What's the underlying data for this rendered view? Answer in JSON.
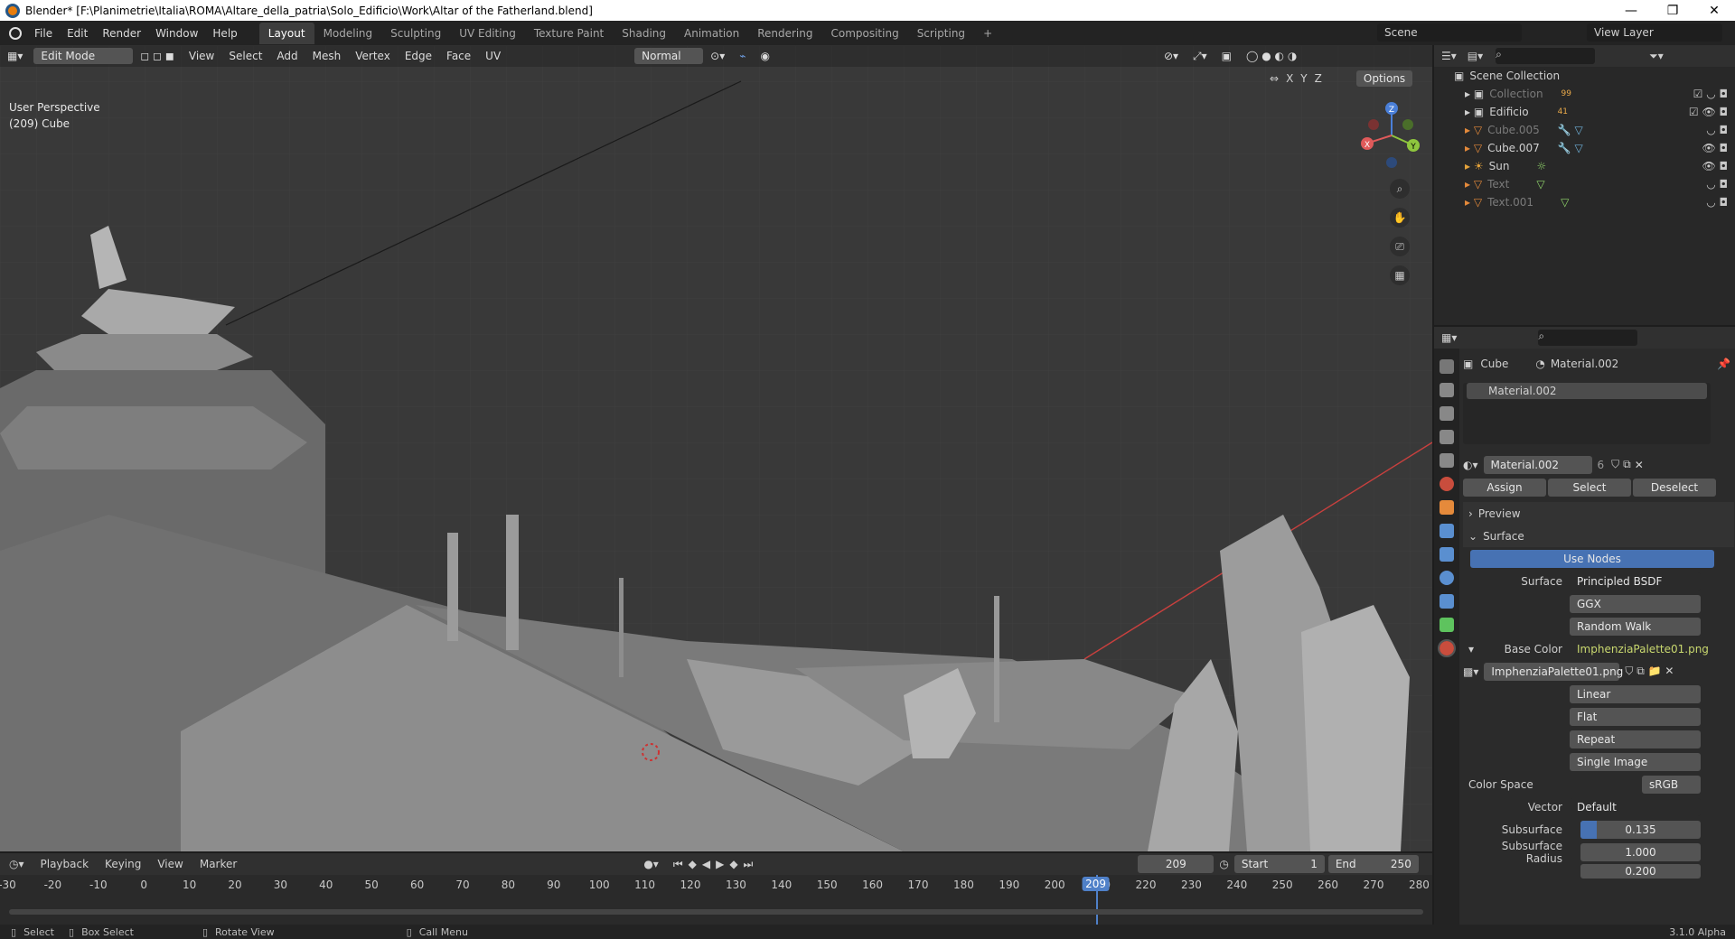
{
  "window": {
    "title": "Blender* [F:\\Planimetrie\\Italia\\ROMA\\Altare_della_patria\\Solo_Edificio\\Work\\Altar of the Fatherland.blend]"
  },
  "menu": [
    "File",
    "Edit",
    "Render",
    "Window",
    "Help"
  ],
  "workspaces": [
    "Layout",
    "Modeling",
    "Sculpting",
    "UV Editing",
    "Texture Paint",
    "Shading",
    "Animation",
    "Rendering",
    "Compositing",
    "Scripting"
  ],
  "active_workspace": "Layout",
  "scene": {
    "name": "Scene",
    "view_layer": "View Layer"
  },
  "viewport": {
    "mode": "Edit Mode",
    "menus": [
      "View",
      "Select",
      "Add",
      "Mesh",
      "Vertex",
      "Edge",
      "Face",
      "UV"
    ],
    "orientation": "Normal",
    "options_label": "Options",
    "axes": [
      "X",
      "Y",
      "Z"
    ],
    "info_line1": "User Perspective",
    "info_line2": "(209) Cube",
    "gizmo": {
      "x": "X",
      "y": "Y",
      "z": "Z"
    }
  },
  "outliner": {
    "root": "Scene Collection",
    "items": [
      {
        "name": "Collection",
        "badge": "99",
        "dim": true
      },
      {
        "name": "Edificio",
        "badge": "41",
        "dim": false
      },
      {
        "name": "Cube.005",
        "dim": true
      },
      {
        "name": "Cube.007",
        "dim": false
      },
      {
        "name": "Sun",
        "dim": false
      },
      {
        "name": "Text",
        "dim": true
      },
      {
        "name": "Text.001",
        "dim": true
      }
    ]
  },
  "properties": {
    "object": "Cube",
    "material": "Material.002",
    "slot": "Material.002",
    "users": "6",
    "assign": "Assign",
    "select": "Select",
    "deselect": "Deselect",
    "preview": "Preview",
    "surface_panel": "Surface",
    "use_nodes": "Use Nodes",
    "surface_label": "Surface",
    "surface_value": "Principled BSDF",
    "distribution": "GGX",
    "subsurface_method": "Random Walk",
    "base_color_label": "Base Color",
    "base_color_value": "ImphenziaPalette01.png",
    "image_name": "ImphenziaPalette01.png",
    "interpolation": "Linear",
    "projection": "Flat",
    "extension": "Repeat",
    "source": "Single Image",
    "color_space_label": "Color Space",
    "color_space_value": "sRGB",
    "vector_label": "Vector",
    "vector_value": "Default",
    "subsurface_label": "Subsurface",
    "subsurface_value": "0.135",
    "subsurface_fraction": 0.135,
    "subsurface_radius_label": "Subsurface Radius",
    "subsurface_radius_1": "1.000",
    "subsurface_radius_2": "0.200"
  },
  "timeline": {
    "menus": [
      "Playback",
      "Keying",
      "View",
      "Marker"
    ],
    "current_frame": "209",
    "start_label": "Start",
    "start": "1",
    "end_label": "End",
    "end": "250",
    "ruler": [
      "-30",
      "-20",
      "-10",
      "0",
      "10",
      "20",
      "30",
      "40",
      "50",
      "60",
      "70",
      "80",
      "90",
      "100",
      "110",
      "120",
      "130",
      "140",
      "150",
      "160",
      "170",
      "180",
      "190",
      "200",
      "210",
      "220",
      "230",
      "240",
      "250",
      "260",
      "270",
      "280"
    ],
    "cursor_value": 209
  },
  "status": {
    "select": "Select",
    "box_select": "Box Select",
    "rotate_view": "Rotate View",
    "call_menu": "Call Menu",
    "version": "3.1.0 Alpha"
  }
}
